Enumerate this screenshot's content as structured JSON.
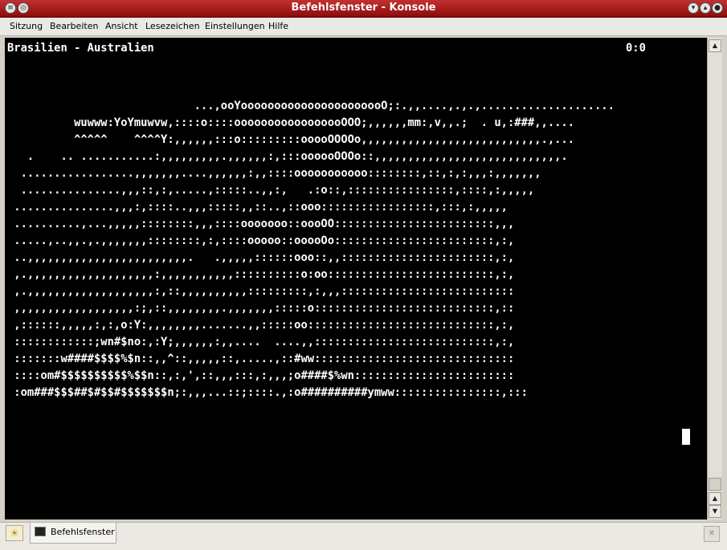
{
  "window": {
    "title": "Befehlsfenster - Konsole"
  },
  "menu": [
    "Sitzung",
    "Bearbeiten",
    "Ansicht",
    "Lesezeichen",
    "Einstellungen",
    "Hilfe"
  ],
  "terminal": {
    "header_left": "Brasilien - Australien",
    "score": "0:0",
    "lines": [
      "",
      "",
      "                            ...,ooYoooooooooooooooooooooO;:.,,....,.,.,....................",
      "          wuwww:YoYmuwvw,::::o::::ooooooooooooooooOOO;,,,,,,mm:,v,,.;  . u,:###,,....",
      "          ^^^^^    ^^^^Y:,,,,,,:::o:::::::::ooooOOOOo,,,,,,,,,,,,,,,,,,,,,,,,,,,.,...",
      "   .    .. ...........:,,,,,,,,,.,,,,,,:,:::oooooOOOo::,,,,,,,,,,,,,,,,,,,,,,,,,,,,.",
      "  .................,,,,,,,....,,,,,,:,,::::ooooooooooo::::::::,::,:,:,,,:,,,,,,,",
      "  ...............,,,::,:,.....,:::::..,,:,   .:o::,::::::::::::::::,::::,:,,,,,",
      " ...............,,,:,::::..,,,:::::,,::..,::ooo:::::::::::::::::,:::,:,,,,,",
      " ..........,...,,,,,::::::::,,,::::ooooooo::oooOO::::::::::::::::::::::::,,,",
      " .....,..,,.,.,,,,,,,::::::::,:,::::ooooo::ooooOo::::::::::::::::::::::::,:,",
      " ..,,,,,,,,,,,,,,,,,,,,,,,,.   .,,,,,::::::ooo::,,:::::::::::::::::::::::,:,",
      " ,.,,,,,,,,,,,,,,,,,,,:,,,,,,,,,,,::::::::::o:oo:::::::::::::::::::::::::,:,",
      " ,.,,,,,,,,,,,,,,,,,,,:,::,,,,,,,,,,:::::::::,:,,,::::::::::::::::::::::::::",
      " ,,,,,,,,,,,,,,,,,,:;,::,,,,,,,,.,,,,,,,:::::o:::::::::::::::::::::::::::,::",
      " ,::::::,,,,,:,:,o:Y:,,,,,,,,.......,,:::::oo::::::::::::::::::::::::::::,:,",
      " ::::::::::::;wn#$no:,:Y;,,,,,,:,,....  ....,,:::::::::::::::::::::::::::,:,",
      " :::::::w####$$$$%$n::,,^::,,,,,::,.....,::#ww::::::::::::::::::::::::::::::",
      " ::::om#$$$$$$$$$$%$$n::,:,',::,,,:::,:,,,;o####$%wn::::::::::::::::::::::::",
      " :om###$$$##$#$$#$$$$$$$n;:,,,...::;::::.,:o##########ymww::::::::::::::::,:::"
    ]
  },
  "taskbar": {
    "tab_label": "Befehlsfenster"
  }
}
